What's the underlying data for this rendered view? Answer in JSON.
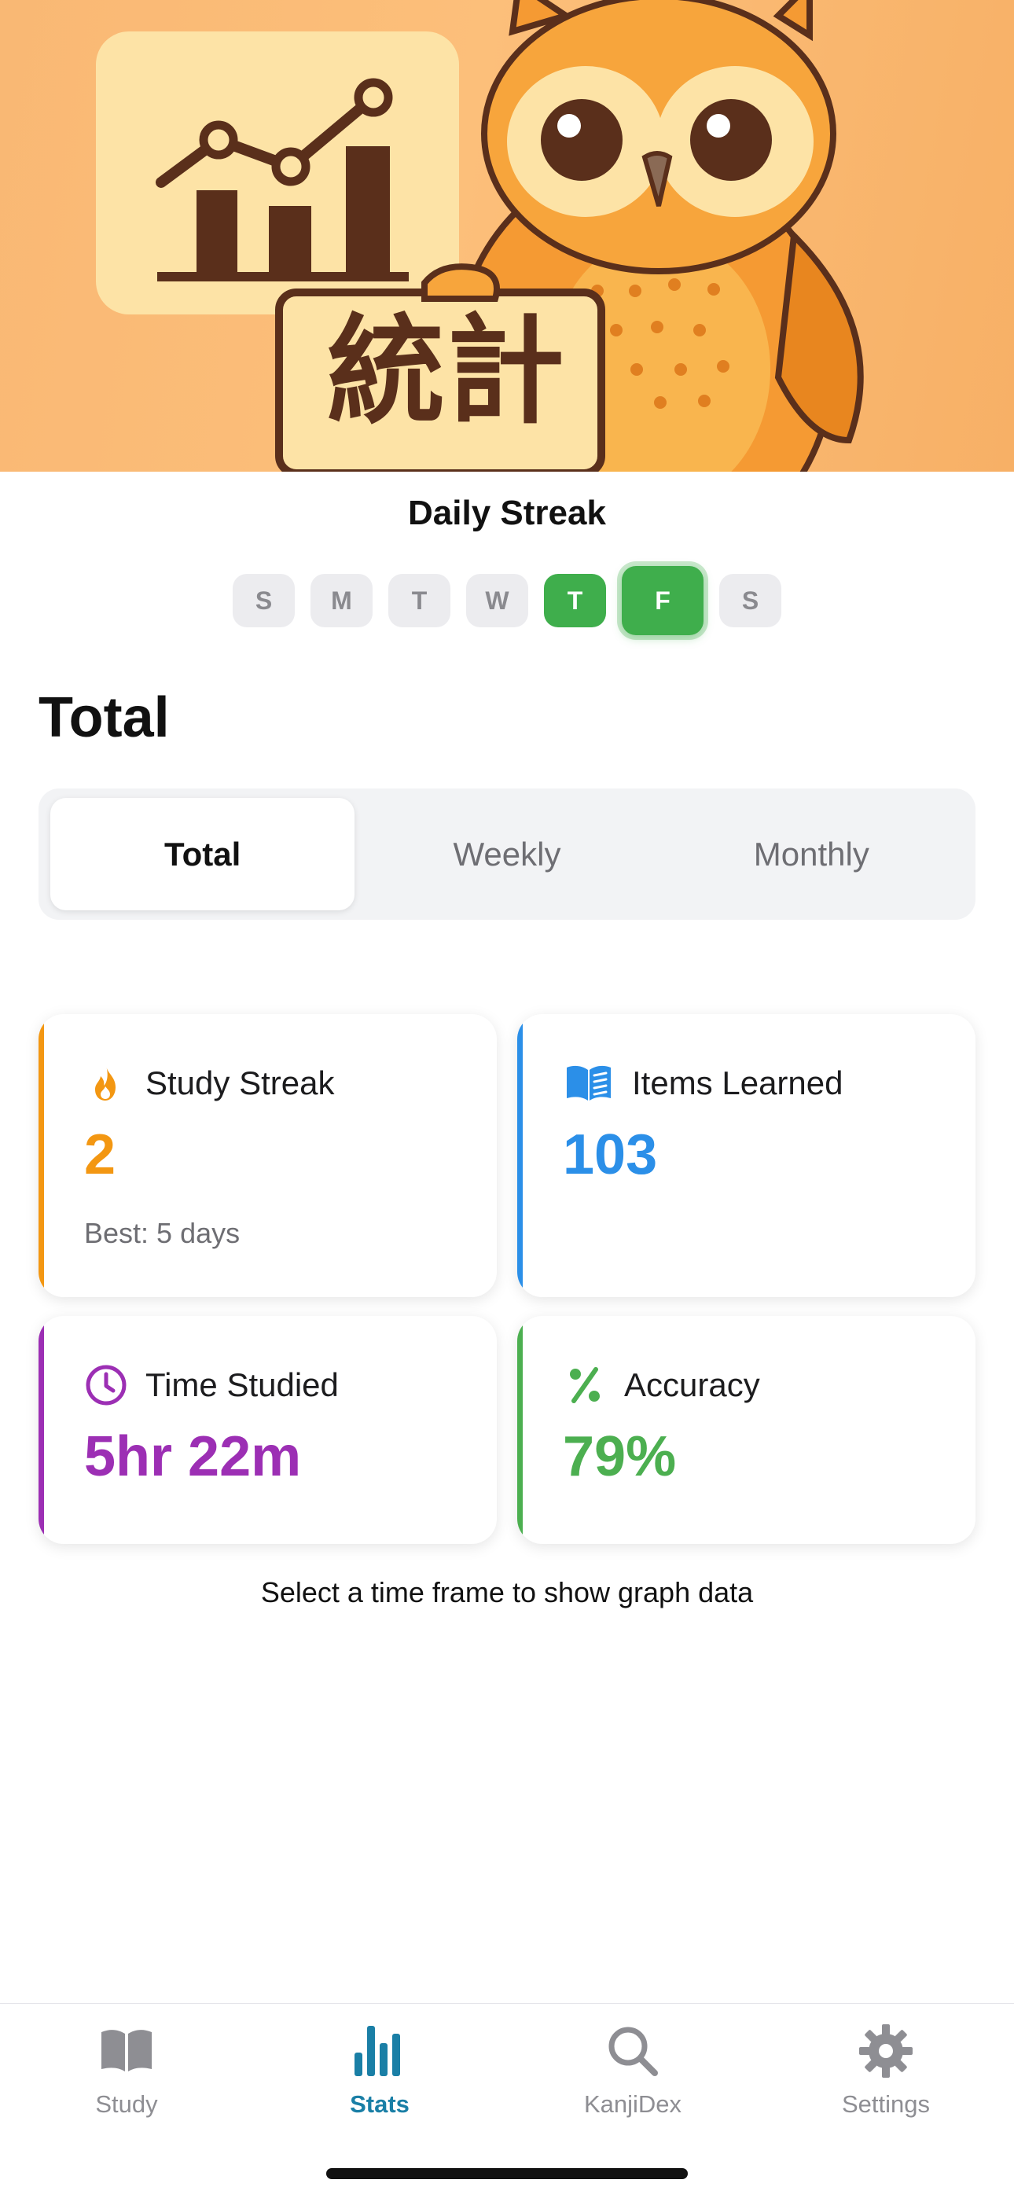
{
  "hero": {
    "sign_text": "統計"
  },
  "streak": {
    "title": "Daily Streak",
    "days": [
      {
        "label": "S",
        "state": "inactive"
      },
      {
        "label": "M",
        "state": "inactive"
      },
      {
        "label": "T",
        "state": "inactive"
      },
      {
        "label": "W",
        "state": "inactive"
      },
      {
        "label": "T",
        "state": "done"
      },
      {
        "label": "F",
        "state": "today"
      },
      {
        "label": "S",
        "state": "inactive"
      }
    ]
  },
  "section_title": "Total",
  "segments": [
    {
      "label": "Total",
      "active": true
    },
    {
      "label": "Weekly",
      "active": false
    },
    {
      "label": "Monthly",
      "active": false
    }
  ],
  "cards": {
    "streak": {
      "label": "Study Streak",
      "value": "2",
      "sub": "Best: 5 days",
      "icon": "flame-icon",
      "accent": "#f39712"
    },
    "items": {
      "label": "Items Learned",
      "value": "103",
      "icon": "book-icon",
      "accent": "#2b8fe8"
    },
    "time": {
      "label": "Time Studied",
      "value": "5hr 22m",
      "icon": "clock-icon",
      "accent": "#9c2fb4"
    },
    "accuracy": {
      "label": "Accuracy",
      "value": "79%",
      "icon": "percent-icon",
      "accent": "#4caf50"
    }
  },
  "hint": "Select a time frame to show graph data",
  "tabs": [
    {
      "label": "Study",
      "icon": "book-icon",
      "active": false
    },
    {
      "label": "Stats",
      "icon": "bar-chart-icon",
      "active": true
    },
    {
      "label": "KanjiDex",
      "icon": "search-icon",
      "active": false
    },
    {
      "label": "Settings",
      "icon": "gear-icon",
      "active": false
    }
  ],
  "colors": {
    "brand_green": "#3fae4c",
    "tab_active": "#1a7fa6"
  }
}
